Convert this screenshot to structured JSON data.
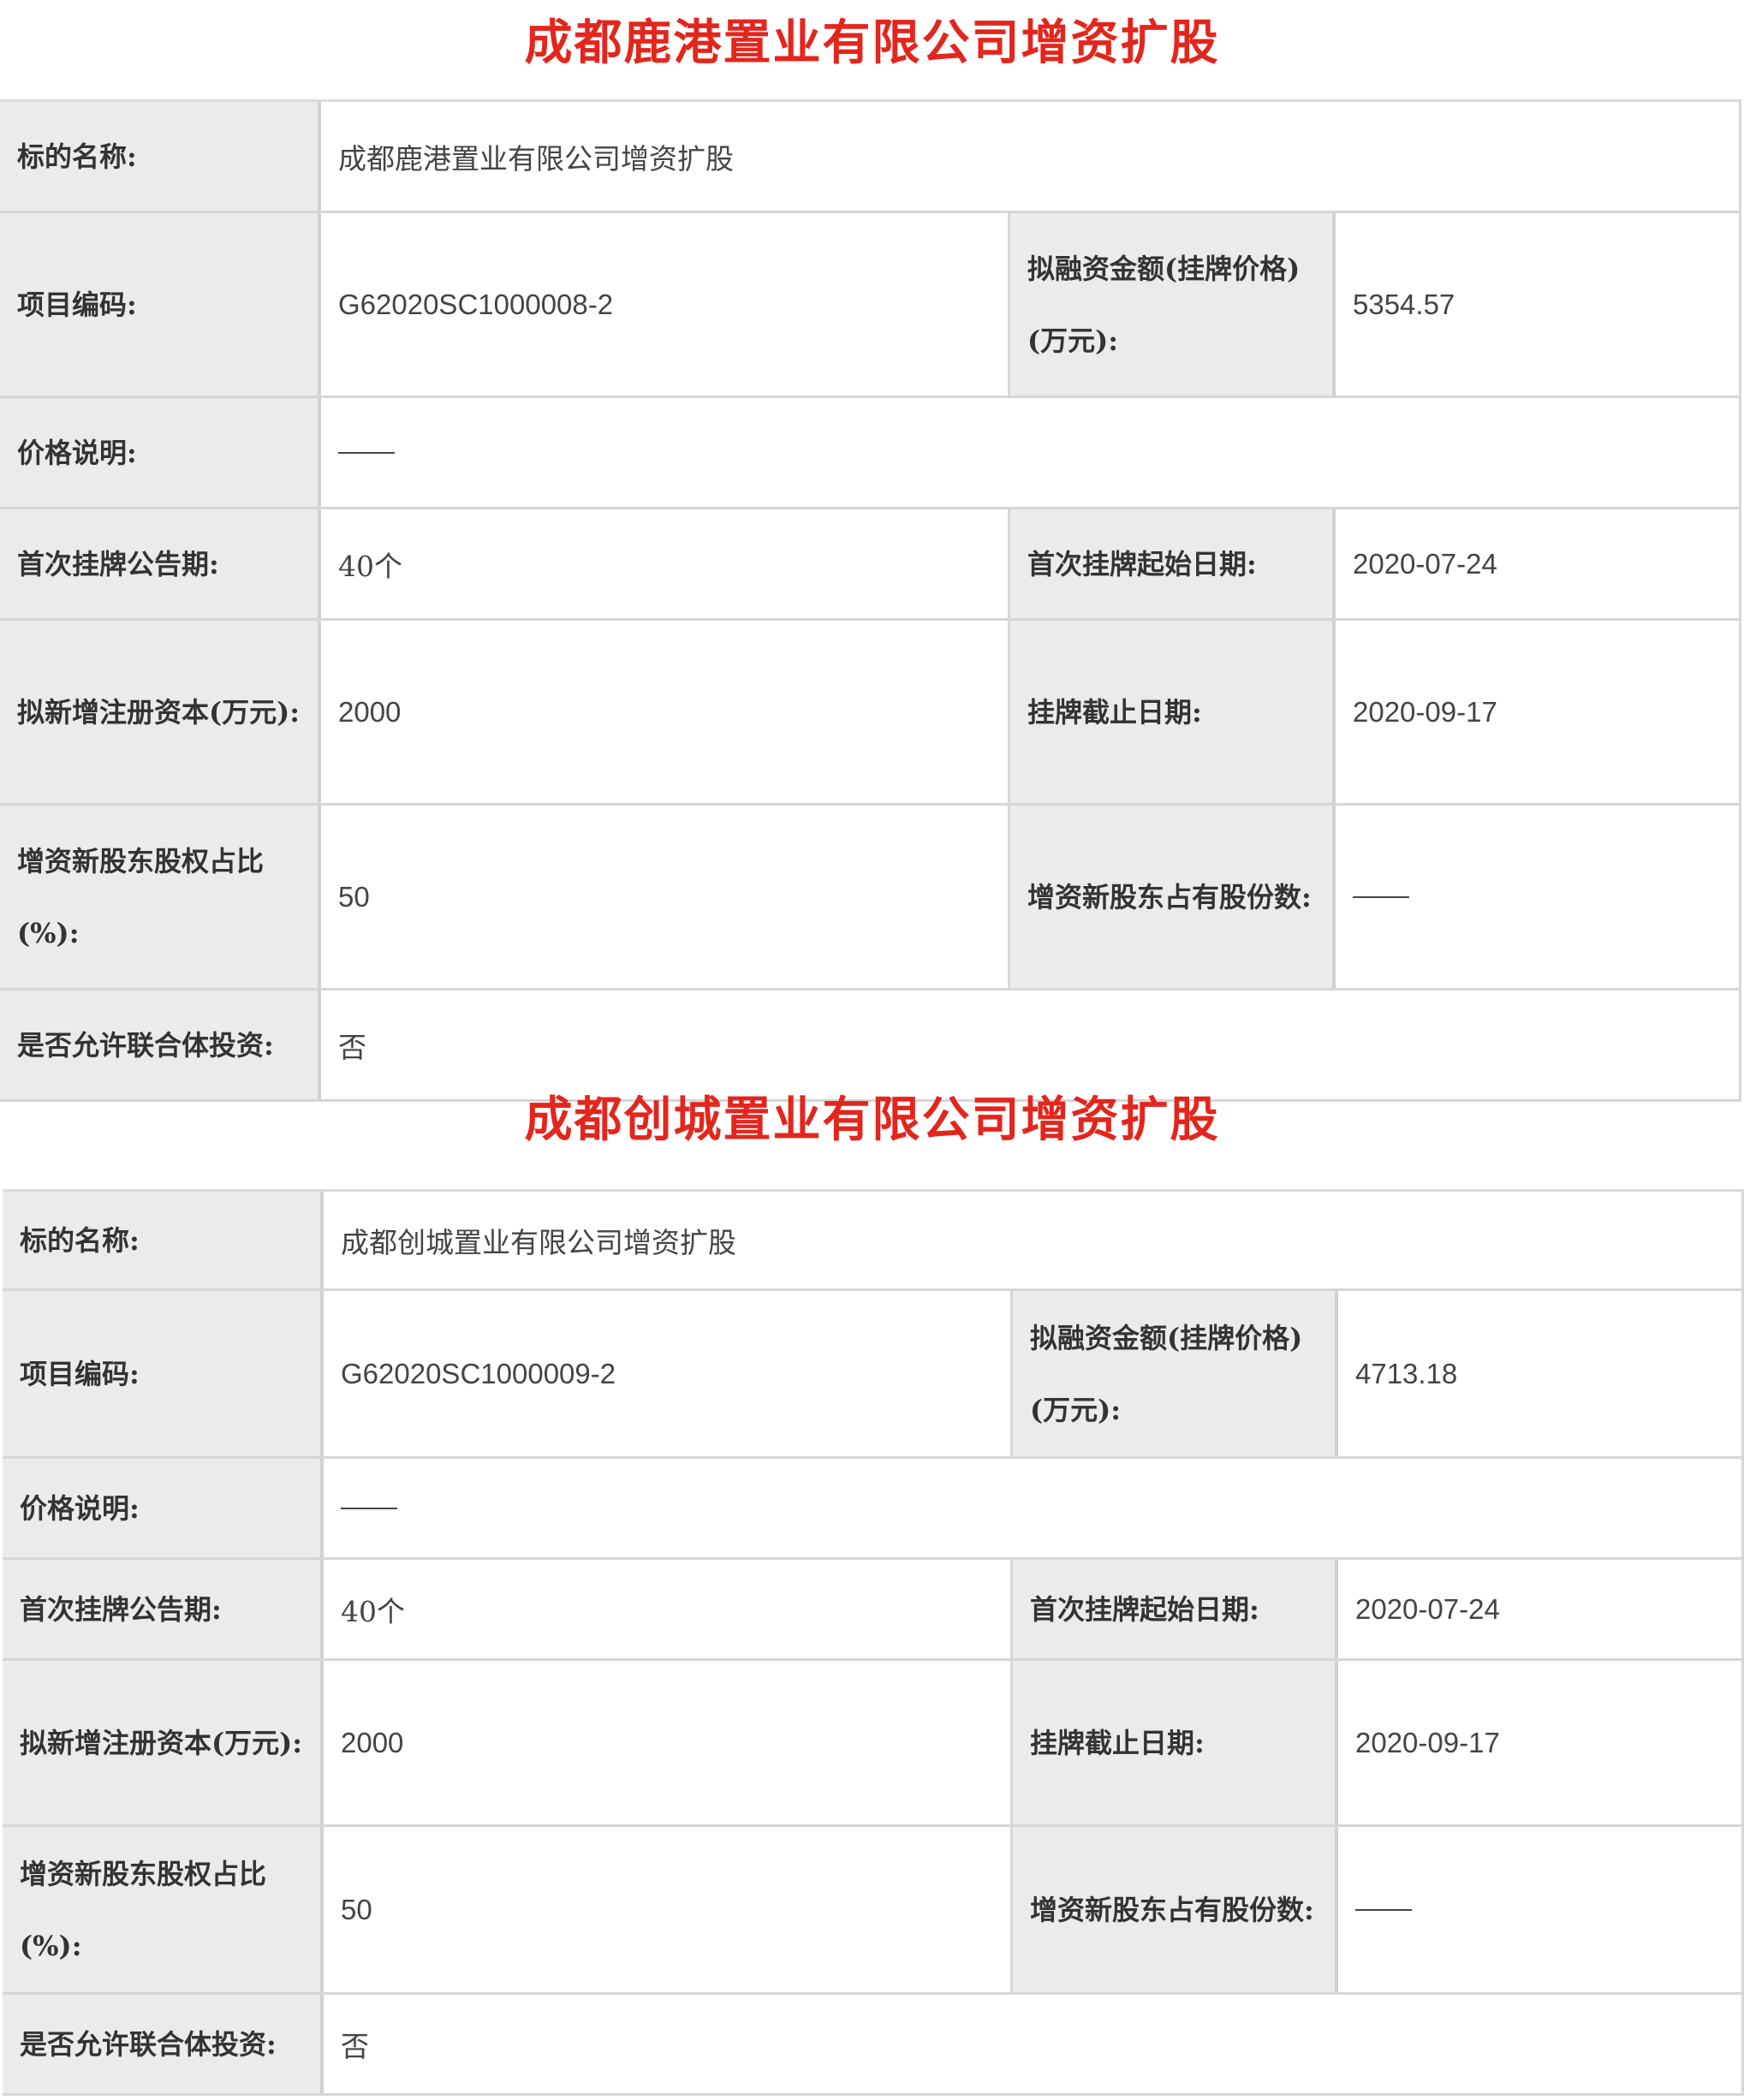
{
  "sections": [
    {
      "title": "成都鹿港置业有限公司增资扩股",
      "labels": {
        "target_name": "标的名称:",
        "project_code": "项目编码:",
        "financing_amount": "拟融资金额(挂牌价格)(万元):",
        "price_note": "价格说明:",
        "first_period": "首次挂牌公告期:",
        "first_start": "首次挂牌起始日期:",
        "new_capital": "拟新增注册资本(万元):",
        "deadline": "挂牌截止日期:",
        "equity_ratio": "增资新股东股权占比(%):",
        "shares": "增资新股东占有股份数:",
        "consortium": "是否允许联合体投资:"
      },
      "values": {
        "target_name": "成都鹿港置业有限公司增资扩股",
        "project_code": "G62020SC1000008-2",
        "financing_amount": "5354.57",
        "price_note": "——",
        "first_period": "40个",
        "first_start": "2020-07-24",
        "new_capital": "2000",
        "deadline": "2020-09-17",
        "equity_ratio": "50",
        "shares": "——",
        "consortium": "否"
      }
    },
    {
      "title": "成都创城置业有限公司增资扩股",
      "labels": {
        "target_name": "标的名称:",
        "project_code": "项目编码:",
        "financing_amount": "拟融资金额(挂牌价格)(万元):",
        "price_note": "价格说明:",
        "first_period": "首次挂牌公告期:",
        "first_start": "首次挂牌起始日期:",
        "new_capital": "拟新增注册资本(万元):",
        "deadline": "挂牌截止日期:",
        "equity_ratio": "增资新股东股权占比(%):",
        "shares": "增资新股东占有股份数:",
        "consortium": "是否允许联合体投资:"
      },
      "values": {
        "target_name": "成都创城置业有限公司增资扩股",
        "project_code": "G62020SC1000009-2",
        "financing_amount": "4713.18",
        "price_note": "——",
        "first_period": "40个",
        "first_start": "2020-07-24",
        "new_capital": "2000",
        "deadline": "2020-09-17",
        "equity_ratio": "50",
        "shares": "——",
        "consortium": "否"
      }
    }
  ]
}
